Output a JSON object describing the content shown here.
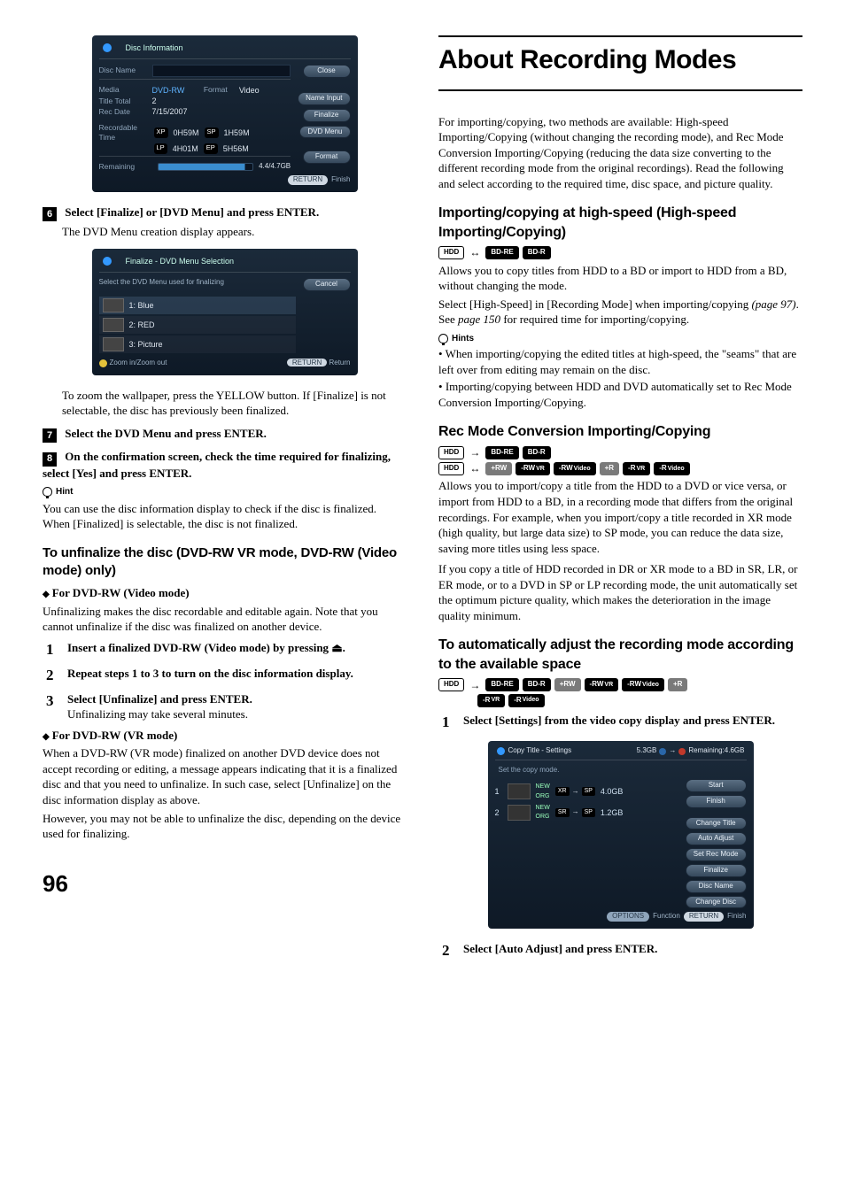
{
  "page_number": "96",
  "disc_info_panel": {
    "title": "Disc Information",
    "rows": {
      "disc_name_label": "Disc Name",
      "media_label": "Media",
      "media_value": "DVD-RW",
      "format_label": "Format",
      "format_value": "Video",
      "title_total_label": "Title Total",
      "title_total_value": "2",
      "rec_date_label": "Rec Date",
      "rec_date_value": "7/15/2007",
      "rec_time_label": "Recordable Time",
      "xp": "XP",
      "xp_val": "0H59M",
      "sp": "SP",
      "sp_val": "1H59M",
      "lp": "LP",
      "lp_val": "4H01M",
      "ep": "EP",
      "ep_val": "5H56M",
      "remaining_label": "Remaining",
      "remaining_value": "4.4/4.7GB"
    },
    "buttons": {
      "close": "Close",
      "name_input": "Name Input",
      "finalize": "Finalize",
      "dvd_menu": "DVD Menu",
      "format": "Format"
    },
    "footer_return": "RETURN",
    "footer_finish": "Finish"
  },
  "step6": {
    "label": "Select [Finalize] or [DVD Menu] and press ENTER.",
    "body": "The DVD Menu creation display appears."
  },
  "finalize_panel": {
    "title": "Finalize - DVD Menu Selection",
    "subtitle": "Select the DVD Menu used for finalizing",
    "cancel": "Cancel",
    "items": {
      "i1": "1: Blue",
      "i2": "2: RED",
      "i3": "3: Picture"
    },
    "zoom": "Zoom in/Zoom out",
    "footer_return": "RETURN",
    "footer_text": "Return"
  },
  "after_finalize_panel": "To zoom the wallpaper, press the YELLOW button. If [Finalize] is not selectable, the disc has previously been finalized.",
  "step7": {
    "label": "Select the DVD Menu and press ENTER."
  },
  "step8": {
    "label": "On the confirmation screen, check the time required for finalizing, select [Yes] and press ENTER."
  },
  "hint_left": {
    "label": "Hint",
    "text": "You can use the disc information display to check if the disc is finalized. When [Finalized] is selectable, the disc is not finalized."
  },
  "unfinalize": {
    "heading": "To unfinalize the disc (DVD-RW VR mode, DVD-RW (Video mode) only)",
    "video_mode_head": "For DVD-RW (Video mode)",
    "video_mode_body": "Unfinalizing makes the disc recordable and editable again. Note that you cannot unfinalize if the disc was finalized on another device.",
    "s1": "Insert a finalized DVD-RW (Video mode) by pressing ",
    "s1_icon": "⏏",
    "s1_end": ".",
    "s2": "Repeat steps 1 to 3 to turn on the disc information display.",
    "s3a": "Select [Unfinalize] and press ENTER.",
    "s3b": "Unfinalizing may take several minutes.",
    "vr_head": "For DVD-RW (VR mode)",
    "vr_body1": "When a DVD-RW (VR mode) finalized on another DVD device does not accept recording or editing, a message appears indicating that it is a finalized disc and that you need to unfinalize. In such case, select [Unfinalize] on the disc information display as above.",
    "vr_body2": "However, you may not be able to unfinalize the disc, depending on the device used for finalizing."
  },
  "right": {
    "title": "About Recording Modes",
    "intro": "For importing/copying, two methods are available: High-speed Importing/Copying (without changing the recording mode), and Rec Mode Conversion Importing/Copying (reducing the data size converting to the different recording mode from the original recordings). Read the following and select according to the required time, disc space, and picture quality.",
    "hs_head": "Importing/copying at high-speed (High-speed Importing/Copying)",
    "hs_body1": "Allows you to copy titles from HDD to a BD or import to HDD from a BD, without changing the mode.",
    "hs_body2a": "Select [High-Speed] in [Recording Mode] when importing/copying ",
    "hs_body2_ref1": "(page 97)",
    "hs_body2b": ". See ",
    "hs_body2_ref2": "page 150",
    "hs_body2c": " for required time for importing/copying.",
    "hints_label": "Hints",
    "hint1": "When importing/copying the edited titles at high-speed, the \"seams\" that are left over from editing may remain on the disc.",
    "hint2": "Importing/copying between HDD and DVD automatically set to Rec Mode Conversion Importing/Copying.",
    "rm_head": "Rec Mode Conversion Importing/Copying",
    "rm_body1": "Allows you to import/copy a title from the HDD to a DVD or vice versa, or import from HDD to a BD, in a recording mode that differs from the original recordings. For example, when you import/copy a title recorded in XR mode (high quality, but large data size) to SP mode, you can reduce the data size, saving more titles using less space.",
    "rm_body2": "If you copy a title of HDD recorded in DR or XR mode to a BD in SR, LR, or ER mode, or to a DVD in SP or LP recording mode, the unit automatically set the optimum picture quality, which makes the deterioration in the image quality minimum.",
    "auto_head": "To automatically adjust the recording mode according to the available space",
    "auto_s1": "Select [Settings] from the video copy display and press ENTER.",
    "auto_s2": "Select [Auto Adjust] and press ENTER."
  },
  "badges": {
    "hdd": "HDD",
    "bdre": "BD-RE",
    "bdr": "BD-R",
    "plusrw": "+RW",
    "dashrw_vr": "-RW",
    "vr": "VR",
    "dashrw_video": "-RW",
    "video": "Video",
    "plusr": "+R",
    "dashr_vr": "-R",
    "dashr_video": "-R"
  },
  "copy_panel": {
    "title": "Copy Title - Settings",
    "cap_used": "5.3GB",
    "remaining": "Remaining:4.6GB",
    "subtitle": "Set the copy mode.",
    "row1": {
      "idx": "1",
      "new": "NEW",
      "org": "ORG",
      "from": "XR",
      "to": "SP",
      "size": "4.0GB"
    },
    "row2": {
      "idx": "2",
      "new": "NEW",
      "org": "ORG",
      "from": "SR",
      "to": "SP",
      "size": "1.2GB"
    },
    "btns": {
      "start": "Start",
      "finish": "Finish",
      "change_title": "Change Title",
      "auto_adjust": "Auto Adjust",
      "set_rec_mode": "Set Rec Mode",
      "finalize": "Finalize",
      "disc_name": "Disc Name",
      "change_disc": "Change Disc"
    },
    "footer_options": "OPTIONS",
    "footer_function": "Function",
    "footer_return": "RETURN",
    "footer_finish": "Finish"
  }
}
